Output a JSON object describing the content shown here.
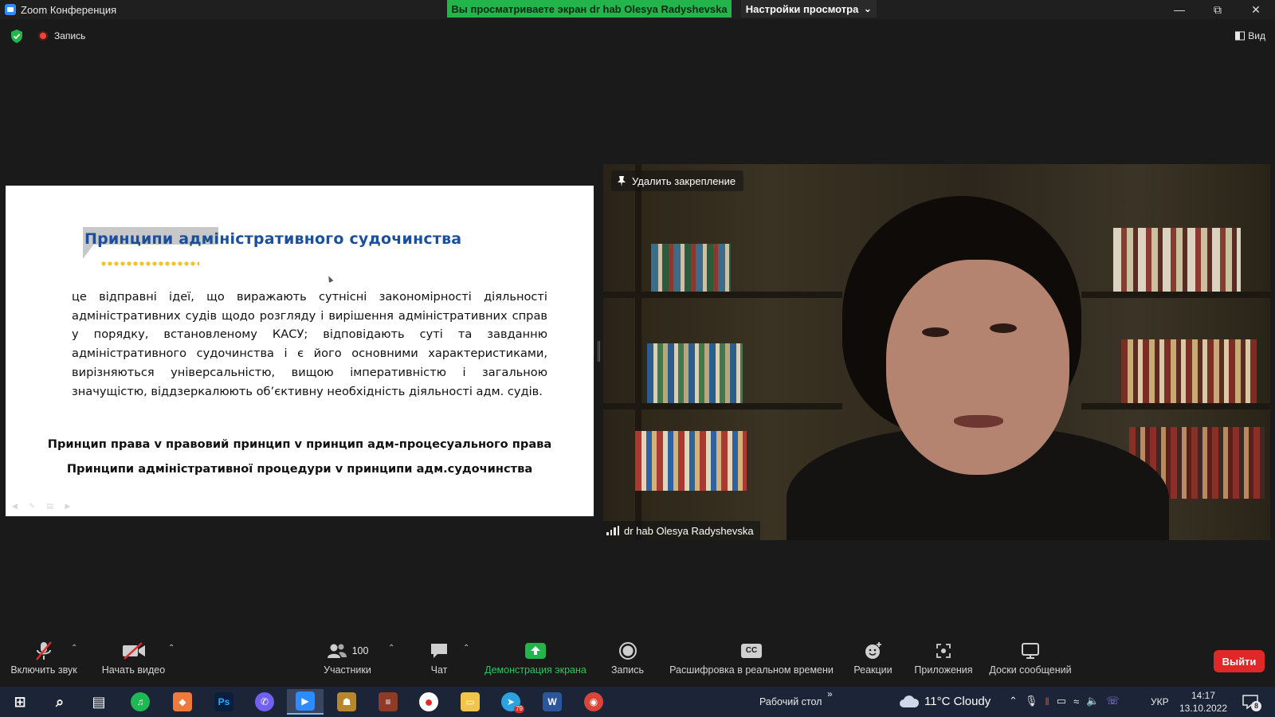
{
  "window": {
    "title": "Zoom Конференция",
    "share_banner": "Вы просматриваете экран dr hab Olesya Radyshevska",
    "view_options": "Настройки просмотра",
    "controls": [
      "minimize-icon",
      "restore-icon",
      "close-icon"
    ]
  },
  "meeting_header": {
    "recording_label": "Запись",
    "view_label": "Вид"
  },
  "slide": {
    "title": "Принципи адміністративного судочинства",
    "body": "це відправні ідеї, що виражають сутнісні закономірності діяльності адміністративних судів щодо розгляду і вирішення адміністративних справ у порядку, встановленому КАСУ; відповідають суті та завданню адміністративного судочинства і є його основними характеристиками, вирізняються універсальністю, вищою імперативністю і загальною значущістю, віддзеркалюють об’єктивну необхідність діяльності адм. судів.",
    "line1": "Принцип права   v   правовий принцип   v   принцип адм-процесуального права",
    "line2": "Принципи адміністративної процедури   v   принципи адм.судочинства"
  },
  "video": {
    "unpin_label": "Удалить закрепление",
    "participant_name": "dr hab Olesya Radyshevska"
  },
  "toolbar": {
    "unmute": "Включить звук",
    "start_video": "Начать видео",
    "participants": "Участники",
    "participants_count": "100",
    "chat": "Чат",
    "share_screen": "Демонстрация экрана",
    "record": "Запись",
    "live_transcript": "Расшифровка в реальном времени",
    "reactions": "Реакции",
    "apps": "Приложения",
    "whiteboards": "Доски сообщений",
    "leave": "Выйти",
    "cc_glyph": "CC",
    "accent_green": "#23b44b",
    "leave_color": "#e02828"
  },
  "taskbar": {
    "apps": [
      {
        "name": "start",
        "glyph": "⊞",
        "color": "#1c2538"
      },
      {
        "name": "search",
        "glyph": "⌕",
        "color": "#1c2538"
      },
      {
        "name": "task-view",
        "glyph": "▤",
        "color": "#1c2538"
      },
      {
        "name": "spotify",
        "glyph": "♫",
        "color": "#1db954"
      },
      {
        "name": "app-orange",
        "glyph": "◆",
        "color": "#f07a3a"
      },
      {
        "name": "photoshop",
        "glyph": "Ps",
        "color": "#0a1f3c"
      },
      {
        "name": "viber",
        "glyph": "✆",
        "color": "#7360f2"
      },
      {
        "name": "zoom",
        "glyph": "▶",
        "color": "#2d8cff"
      },
      {
        "name": "game",
        "glyph": "☗",
        "color": "#b8862c"
      },
      {
        "name": "winrar",
        "glyph": "≡",
        "color": "#8e3b2a"
      },
      {
        "name": "recorder",
        "glyph": "●",
        "color": "#ffffff"
      },
      {
        "name": "explorer",
        "glyph": "▭",
        "color": "#f3c44a"
      },
      {
        "name": "telegram",
        "glyph": "➤",
        "color": "#2aa3e0"
      },
      {
        "name": "word",
        "glyph": "W",
        "color": "#2b579a"
      },
      {
        "name": "chrome",
        "glyph": "◉",
        "color": "#db4437"
      }
    ],
    "telegram_badge": "79",
    "desktop_label": "Рабочий стол",
    "weather": "11°C  Cloudy",
    "language": "УКР",
    "time": "14:17",
    "date": "13.10.2022",
    "notifications": "8"
  }
}
